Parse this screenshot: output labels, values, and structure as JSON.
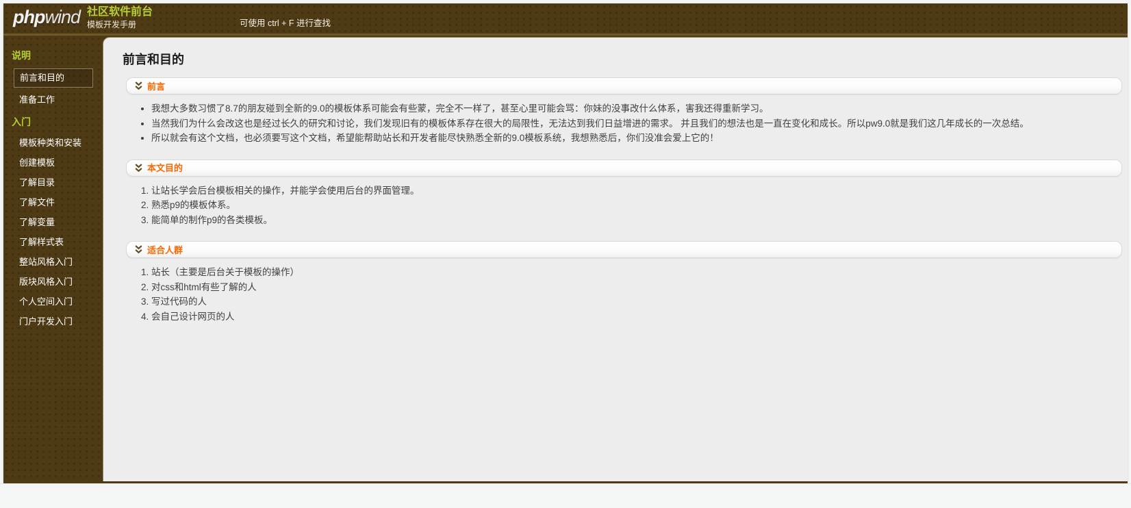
{
  "header": {
    "logo_bold": "php",
    "logo_light": "wind",
    "site_title": "社区软件前台",
    "subtitle": "模板开发手册",
    "search_hint": "可使用 ctrl + F 进行查找"
  },
  "sidebar": {
    "groups": [
      {
        "heading": "说明",
        "items": [
          {
            "label": "前言和目的",
            "selected": true
          },
          {
            "label": "准备工作",
            "selected": false
          }
        ]
      },
      {
        "heading": "入门",
        "items": [
          {
            "label": "模板种类和安装",
            "selected": false
          },
          {
            "label": "创建模板",
            "selected": false
          },
          {
            "label": "了解目录",
            "selected": false
          },
          {
            "label": "了解文件",
            "selected": false
          },
          {
            "label": "了解变量",
            "selected": false
          },
          {
            "label": "了解样式表",
            "selected": false
          },
          {
            "label": "整站风格入门",
            "selected": false
          },
          {
            "label": "版块风格入门",
            "selected": false
          },
          {
            "label": "个人空间入门",
            "selected": false
          },
          {
            "label": "门户开发入门",
            "selected": false
          }
        ]
      }
    ]
  },
  "main": {
    "page_title": "前言和目的",
    "sections": [
      {
        "title": "前言",
        "icon": "chevron-double-down-icon",
        "list_type": "bullet",
        "items": [
          "我想大多数习惯了8.7的朋友碰到全新的9.0的模板体系可能会有些蒙，完全不一样了，甚至心里可能会骂：你妹的没事改什么体系，害我还得重新学习。",
          "当然我们为什么会改这也是经过长久的研究和讨论，我们发现旧有的模板体系存在很大的局限性，无法达到我们日益增进的需求。 并且我们的想法也是一直在变化和成长。所以pw9.0就是我们这几年成长的一次总结。",
          "所以就会有这个文档，也必须要写这个文档，希望能帮助站长和开发者能尽快熟悉全新的9.0模板系统，我想熟悉后，你们没准会爱上它的！"
        ]
      },
      {
        "title": "本文目的",
        "icon": "chevron-double-down-icon",
        "list_type": "numbered",
        "items": [
          "让站长学会后台模板相关的操作，并能学会使用后台的界面管理。",
          "熟悉p9的模板体系。",
          "能简单的制作p9的各类模板。"
        ]
      },
      {
        "title": "适合人群",
        "icon": "chevron-double-down-icon",
        "list_type": "numbered",
        "items": [
          "站长（主要是后台关于模板的操作）",
          "对css和html有些了解的人",
          "写过代码的人",
          "会自己设计网页的人"
        ]
      }
    ]
  },
  "colors": {
    "header_brown": "#4e3a15",
    "header_border": "#6d5827",
    "brand_green": "#b6ce34",
    "accent_orange": "#ff6600",
    "content_bg": "#ededed",
    "chevron_icon": "#5f4d1f"
  }
}
